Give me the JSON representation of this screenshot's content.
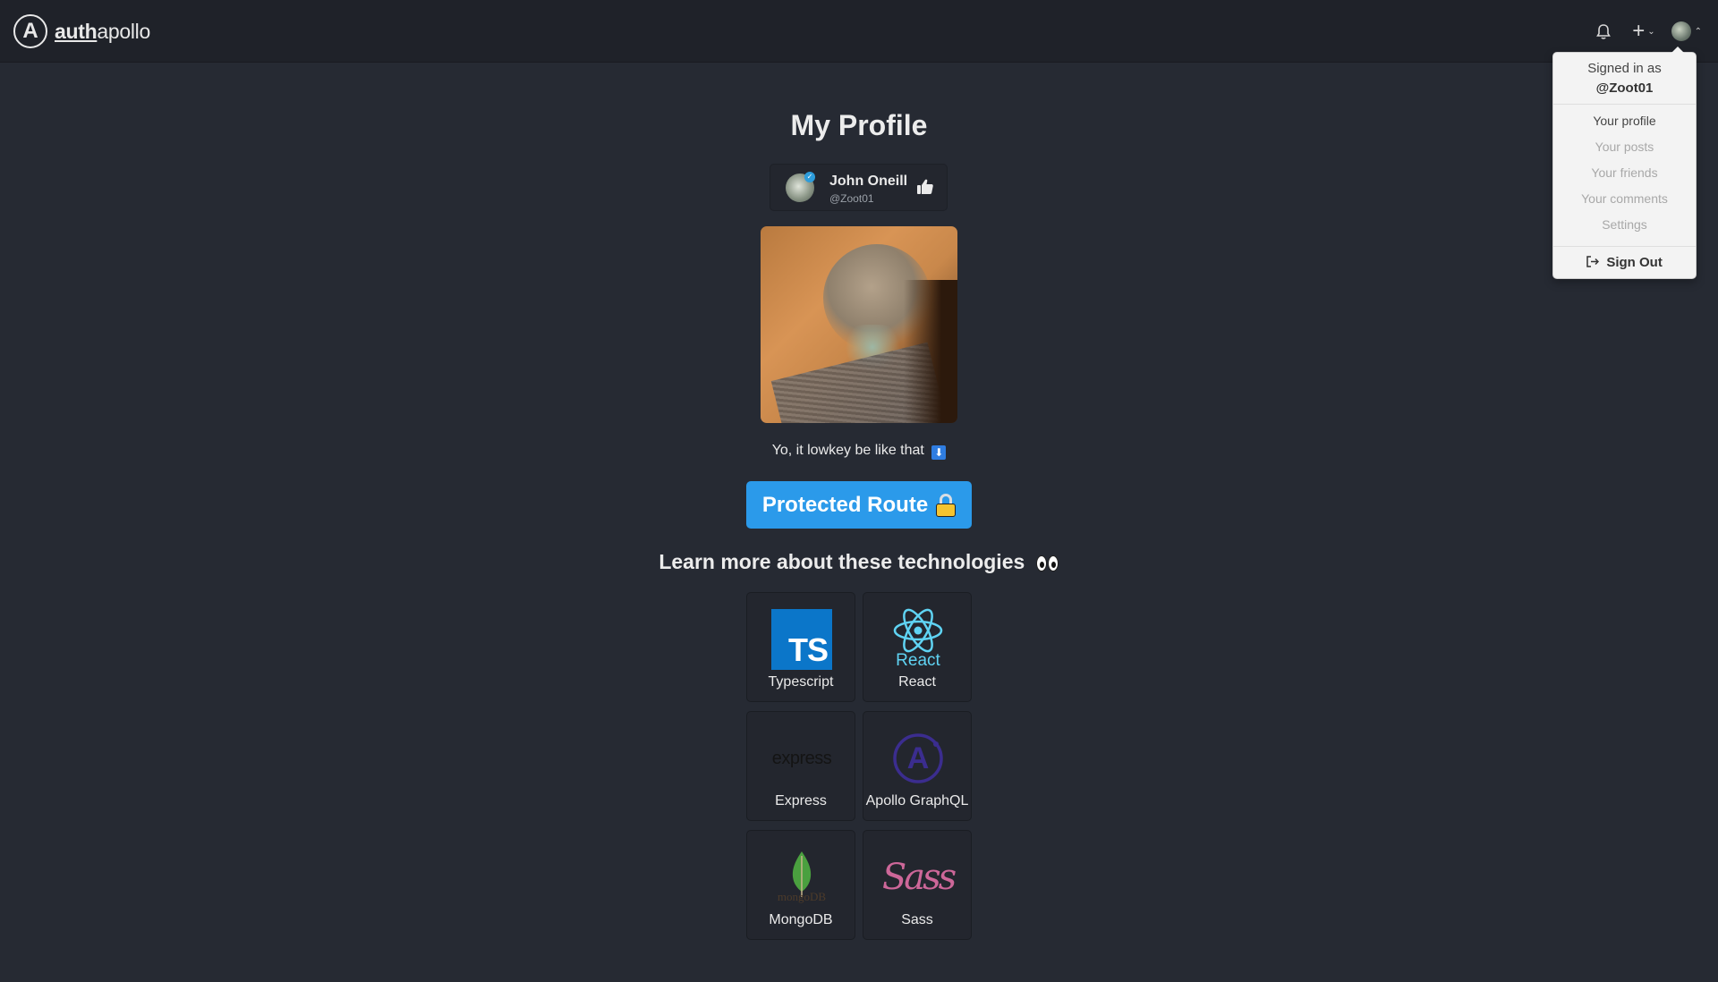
{
  "header": {
    "brand_bold": "auth",
    "brand_light": "apollo",
    "logo_letter": "A",
    "icons": [
      "bell-icon",
      "plus-icon",
      "chevron-down-icon",
      "avatar",
      "chevron-up-icon"
    ]
  },
  "dropdown": {
    "signed_in_as": "Signed in as",
    "username": "@Zoot01",
    "items": [
      {
        "label": "Your profile"
      },
      {
        "label": "Your posts"
      },
      {
        "label": "Your friends"
      },
      {
        "label": "Your comments"
      },
      {
        "label": "Settings"
      }
    ],
    "sign_out": "Sign Out"
  },
  "profile": {
    "title": "My Profile",
    "name": "John Oneill",
    "handle": "@Zoot01",
    "caption": "Yo, it lowkey be like that",
    "caption_emoji": "⬇"
  },
  "protected_button": "Protected Route",
  "learn_heading": "Learn more about these technologies",
  "technologies": [
    {
      "label": "Typescript",
      "logo_text": "TS"
    },
    {
      "label": "React",
      "logo_text": "React"
    },
    {
      "label": "Express",
      "logo_text": "express"
    },
    {
      "label": "Apollo GraphQL",
      "logo_text": "A"
    },
    {
      "label": "MongoDB",
      "logo_text": "mongoDB"
    },
    {
      "label": "Sass",
      "logo_text": "Sass"
    }
  ],
  "colors": {
    "background": "#262a33",
    "topbar": "#1f2229",
    "accent": "#2b9aea",
    "dropdown_bg": "#f3f3f3"
  }
}
